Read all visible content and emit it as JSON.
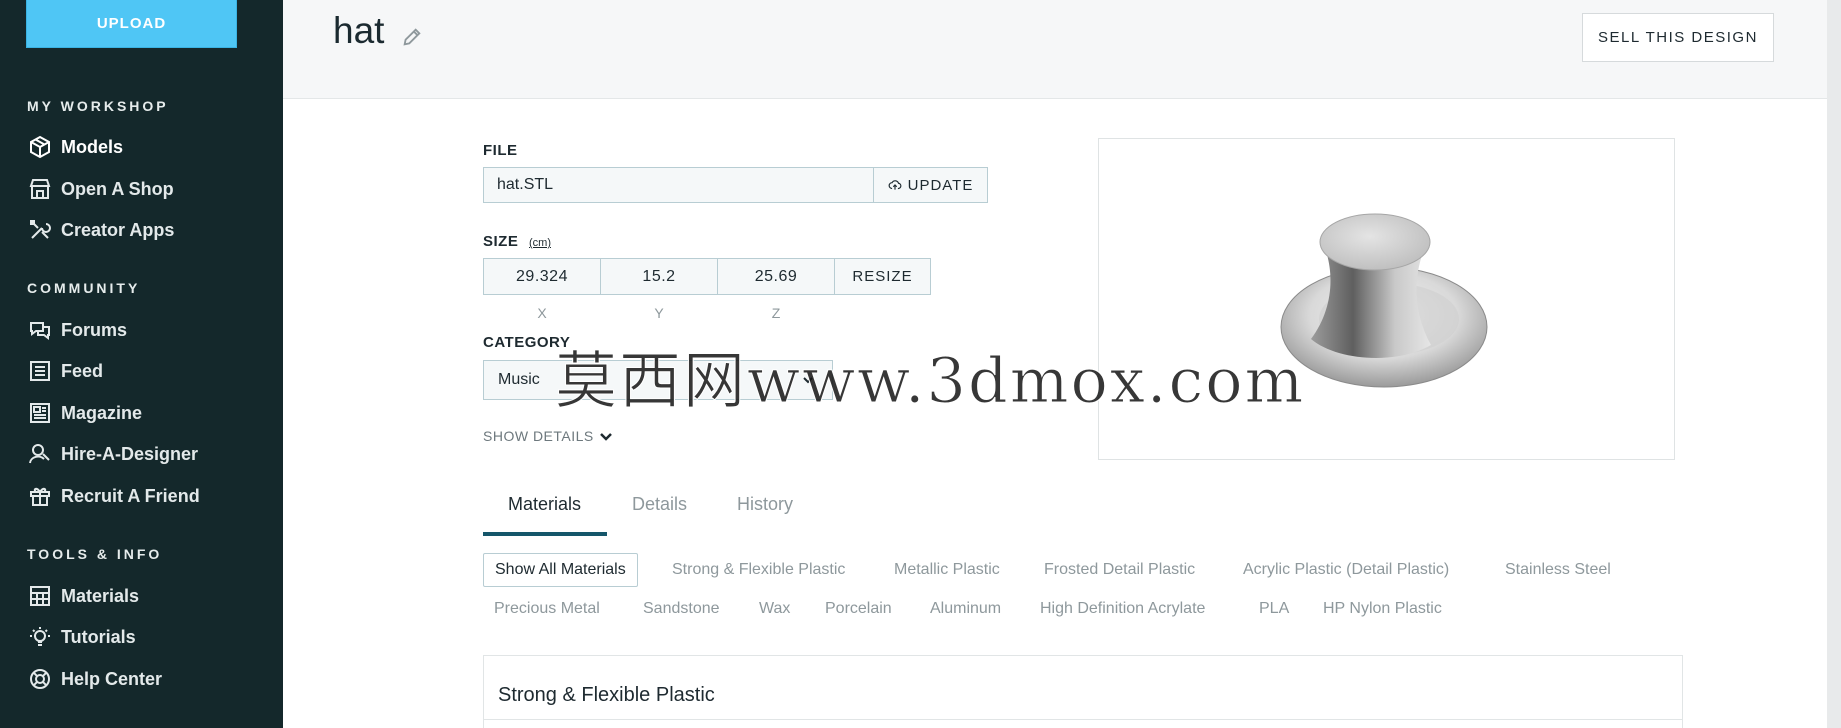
{
  "sidebar": {
    "upload_label": "UPLOAD",
    "sections": [
      {
        "title": "MY WORKSHOP",
        "items": [
          {
            "label": "Models",
            "icon": "cube-icon",
            "active": true
          },
          {
            "label": "Open A Shop",
            "icon": "shop-icon"
          },
          {
            "label": "Creator Apps",
            "icon": "tools-icon"
          }
        ]
      },
      {
        "title": "COMMUNITY",
        "items": [
          {
            "label": "Forums",
            "icon": "chat-icon"
          },
          {
            "label": "Feed",
            "icon": "feed-icon"
          },
          {
            "label": "Magazine",
            "icon": "magazine-icon"
          },
          {
            "label": "Hire-A-Designer",
            "icon": "designer-icon"
          },
          {
            "label": "Recruit A Friend",
            "icon": "gift-icon"
          }
        ]
      },
      {
        "title": "TOOLS & INFO",
        "items": [
          {
            "label": "Materials",
            "icon": "materials-icon"
          },
          {
            "label": "Tutorials",
            "icon": "lightbulb-icon"
          },
          {
            "label": "Help Center",
            "icon": "lifebuoy-icon"
          }
        ]
      }
    ]
  },
  "header": {
    "title": "hat",
    "sell_label": "SELL THIS DESIGN"
  },
  "form": {
    "file_label": "FILE",
    "file_value": "hat.STL",
    "update_label": "UPDATE",
    "size_label": "SIZE",
    "size_unit": "(cm)",
    "size": {
      "x": "29.324",
      "y": "15.2",
      "z": "25.69"
    },
    "axis": {
      "x": "X",
      "y": "Y",
      "z": "Z"
    },
    "resize_label": "RESIZE",
    "category_label": "CATEGORY",
    "category_value": "Music",
    "show_details_label": "SHOW DETAILS"
  },
  "watermark": "莫西网www.3dmox.com",
  "tabs": [
    {
      "label": "Materials",
      "active": true
    },
    {
      "label": "Details"
    },
    {
      "label": "History"
    }
  ],
  "material_filters": [
    "Show All Materials",
    "Strong & Flexible Plastic",
    "Metallic Plastic",
    "Frosted Detail Plastic",
    "Acrylic Plastic (Detail Plastic)",
    "Stainless Steel",
    "Precious Metal",
    "Sandstone",
    "Wax",
    "Porcelain",
    "Aluminum",
    "High Definition Acrylate",
    "PLA",
    "HP Nylon Plastic"
  ],
  "material_card": {
    "title": "Strong & Flexible Plastic"
  },
  "colors": {
    "sidebar_bg": "#14282b",
    "upload_bg": "#4fc6f5",
    "tab_accent": "#15566a"
  }
}
